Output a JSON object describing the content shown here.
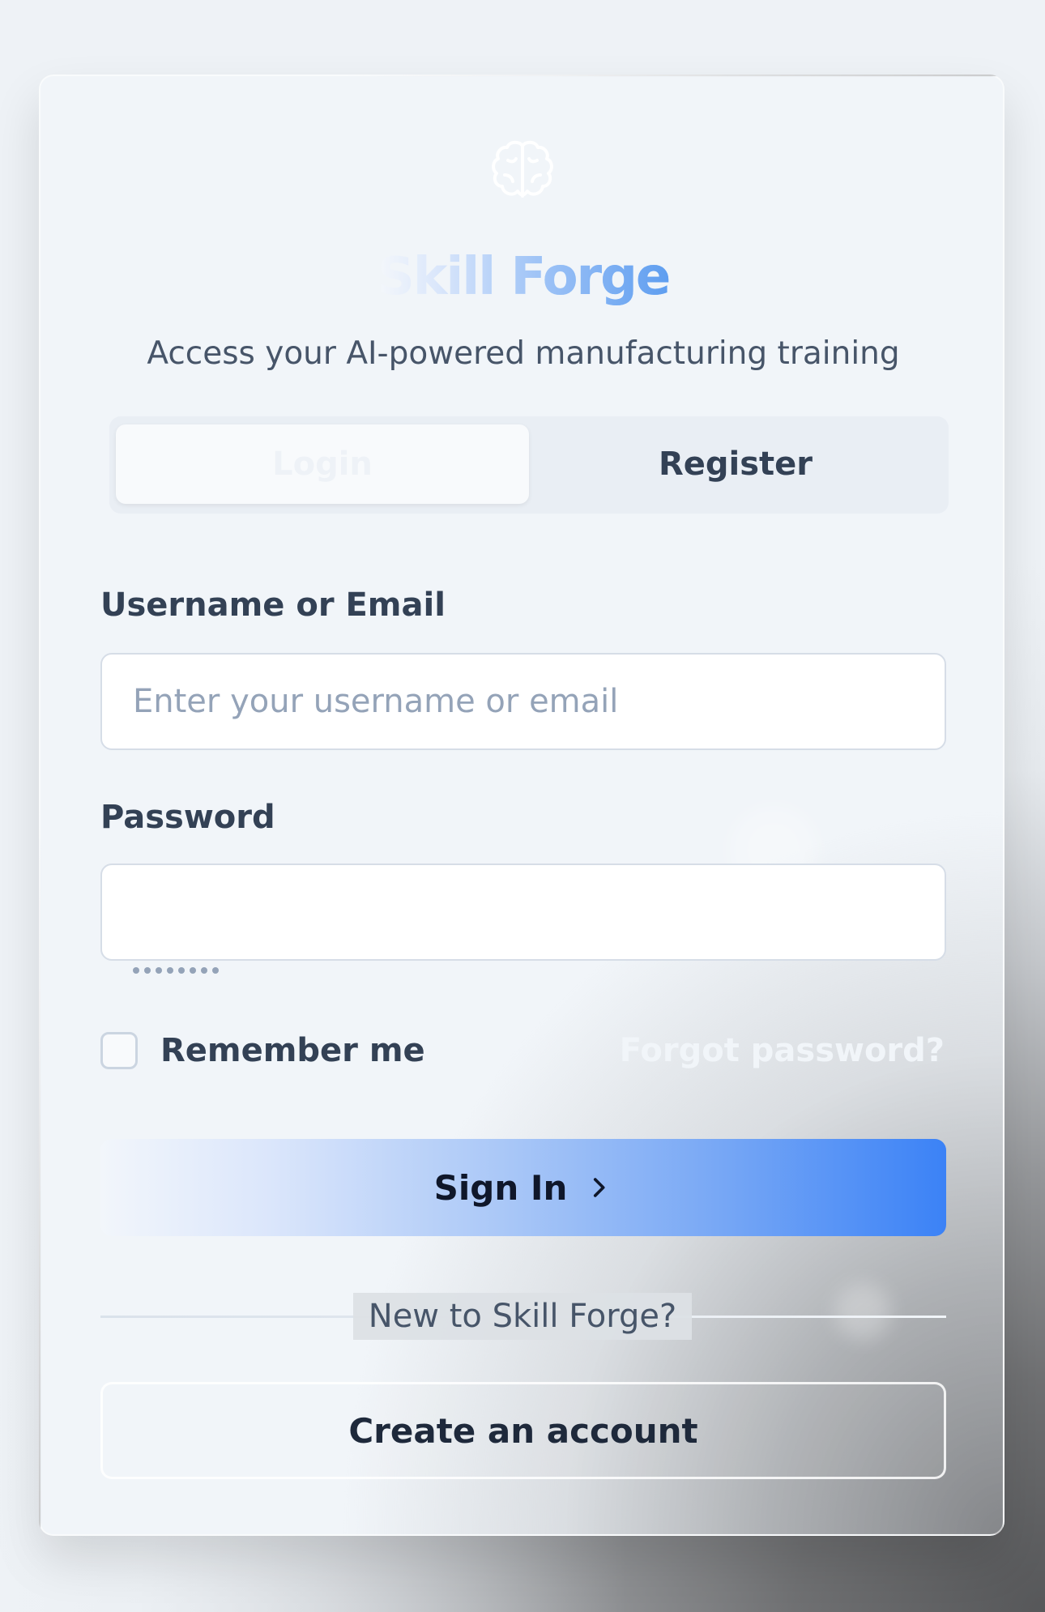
{
  "brand": {
    "name": "Skill Forge",
    "subtitle": "Access your AI-powered manufacturing training",
    "logo_icon": "brain-icon"
  },
  "tabs": [
    {
      "label": "Login",
      "active": true
    },
    {
      "label": "Register",
      "active": false
    }
  ],
  "form": {
    "username_label": "Username or Email",
    "username_placeholder": "Enter your username or email",
    "password_label": "Password",
    "password_value": "••••••••",
    "remember_label": "Remember me",
    "remember_checked": false,
    "forgot_label": "Forgot password?",
    "submit_label": "Sign In",
    "submit_icon": "chevron-right-icon"
  },
  "footer": {
    "divider_text": "New to Skill Forge?",
    "create_label": "Create an account"
  },
  "colors": {
    "accent": "#3b82f6",
    "accent_light": "#93c5fd",
    "text": "#334155",
    "muted": "#94a3b8"
  }
}
